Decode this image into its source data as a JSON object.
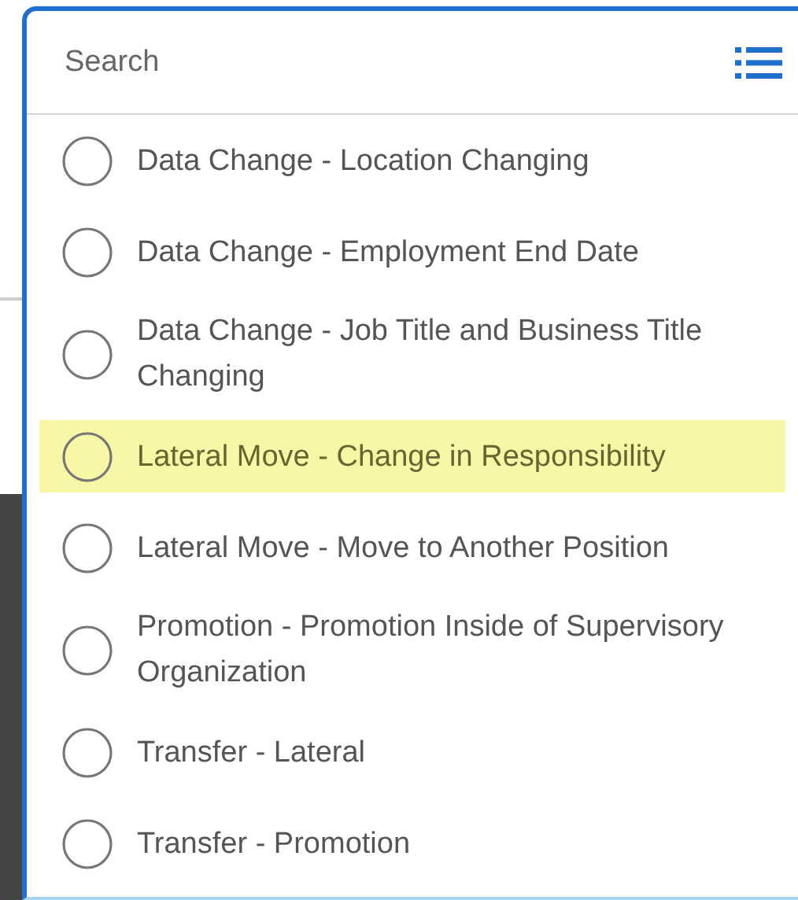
{
  "search": {
    "placeholder": "Search"
  },
  "items": [
    {
      "label": "Data Change - Location Changing",
      "highlighted": false,
      "selected": false
    },
    {
      "label": "Data Change - Employment End Date",
      "highlighted": false,
      "selected": false
    },
    {
      "label": "Data Change - Job Title and Business Title Changing",
      "highlighted": false,
      "selected": false
    },
    {
      "label": "Lateral Move - Change in Responsibility",
      "highlighted": true,
      "selected": false
    },
    {
      "label": "Lateral Move - Move to Another Position",
      "highlighted": false,
      "selected": false
    },
    {
      "label": "Promotion - Promotion Inside of Supervisory Organization",
      "highlighted": false,
      "selected": false
    },
    {
      "label": "Transfer - Lateral",
      "highlighted": false,
      "selected": false
    },
    {
      "label": "Transfer - Promotion",
      "highlighted": false,
      "selected": false
    }
  ]
}
